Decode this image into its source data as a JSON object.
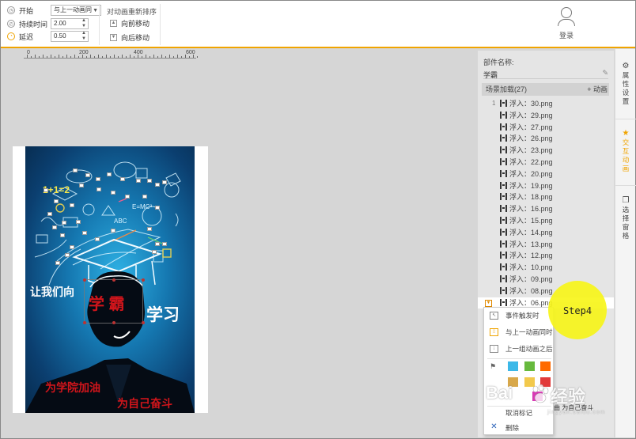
{
  "toolbar": {
    "start_label": "开始",
    "start_value": "与上一动画同",
    "duration_label": "持续时间",
    "duration_value": "2.00",
    "delay_label": "延迟",
    "delay_value": "0.50",
    "reorder_title": "对动画重新排序",
    "move_forward": "向前移动",
    "move_backward": "向后移动",
    "login_label": "登录"
  },
  "ruler": {
    "ticks": [
      "0",
      "200",
      "400",
      "600"
    ]
  },
  "poster": {
    "line_left": "让我们向",
    "highlight": "学 霸",
    "line_right": "学习",
    "bottom_line1": "为学院加油",
    "bottom_line2": "为自己奋斗",
    "formula1": "1+1=2",
    "formula2": "E=MC²",
    "formula3": "ABC"
  },
  "panel": {
    "component_name_label": "部件名称:",
    "component_name_value": "学霸",
    "scene_header": "场景加载(27)",
    "add_animation": "+ 动画",
    "first_index": "1",
    "items": [
      "浮入：30.png",
      "浮入：29.png",
      "浮入：27.png",
      "浮入：26.png",
      "浮入：23.png",
      "浮入：22.png",
      "浮入：20.png",
      "浮入：19.png",
      "浮入：18.png",
      "浮入：16.png",
      "浮入：15.png",
      "浮入：14.png",
      "浮入：13.png",
      "浮入：12.png",
      "浮入：10.png",
      "浮入：09.png",
      "浮入：08.png",
      "浮入：06.png"
    ],
    "behind_popup_text": "曲 为自己奋斗"
  },
  "popup": {
    "event_trigger": "事件触发时",
    "with_previous": "与上一动画同时",
    "after_previous": "上一组动画之后",
    "clear_mark": "取消标记",
    "delete": "删除",
    "swatch_colors": [
      "#3cb8e8",
      "#67b93d",
      "#ff6a00",
      "#d8a84a",
      "#f2c94c",
      "#d93ab5",
      "#e23b3b"
    ]
  },
  "step_label": "Step4",
  "watermark": {
    "text_left": "Bai",
    "text_right": "经验",
    "sub": "jingyan.baidu.com"
  },
  "side_tabs": {
    "properties": "属性设置",
    "interactive": "交互动画",
    "select_window": "选择窗格"
  },
  "colors": {
    "accent": "#f0a400",
    "poster_red": "#d0151b"
  }
}
